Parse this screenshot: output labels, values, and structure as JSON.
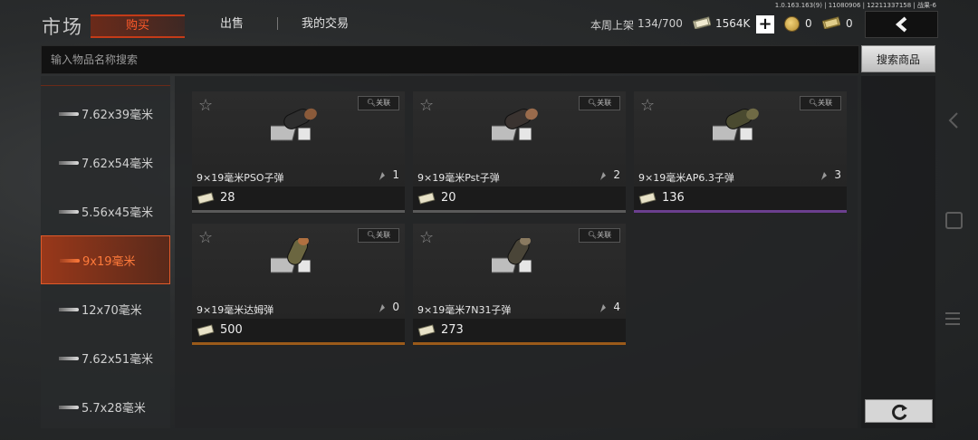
{
  "header": {
    "title": "市场",
    "tabs": [
      {
        "label": "购买",
        "active": true
      },
      {
        "label": "出售",
        "active": false
      },
      {
        "label": "我的交易",
        "active": false
      }
    ],
    "version": "1.0.163.163(9) | 11080906 | 12211337158 | 战果-6",
    "weekly_label": "本周上架",
    "weekly_count": "134/700",
    "money": "1564K",
    "coins": "0",
    "bonds": "0",
    "icons": {
      "plus": "plus-icon",
      "coin": "coin-icon",
      "back": "back-arrow-icon"
    }
  },
  "search": {
    "placeholder": "输入物品名称搜索",
    "button_label": "搜索商品"
  },
  "sidebar": {
    "items": [
      {
        "label": "7.62x39毫米",
        "active": false
      },
      {
        "label": "7.62x54毫米",
        "active": false
      },
      {
        "label": "5.56x45毫米",
        "active": false
      },
      {
        "label": "9x19毫米",
        "active": true
      },
      {
        "label": "12x70毫米",
        "active": false
      },
      {
        "label": "7.62x51毫米",
        "active": false
      },
      {
        "label": "5.7x28毫米",
        "active": false
      }
    ]
  },
  "items": [
    {
      "name": "9×19毫米PSO子弹",
      "qty": "1",
      "price": "28",
      "related": "关联",
      "tip": "#8a5a3a",
      "rarity": "#5a5a5a"
    },
    {
      "name": "9×19毫米Pst子弹",
      "qty": "2",
      "price": "20",
      "related": "关联",
      "tip": "#9a6b4c",
      "rarity": "#5a5a5a"
    },
    {
      "name": "9×19毫米AP6.3子弹",
      "qty": "3",
      "price": "136",
      "related": "关联",
      "tip": "#6f6a45",
      "rarity": "#6b3f8f"
    },
    {
      "name": "9×19毫米达姆弹",
      "qty": "0",
      "price": "500",
      "related": "关联",
      "tip": "#b07040",
      "rarity": "#9a5a1a"
    },
    {
      "name": "9×19毫米7N31子弹",
      "qty": "4",
      "price": "273",
      "related": "关联",
      "tip": "#8a7a60",
      "rarity": "#9a5a1a"
    }
  ],
  "colors": {
    "accent": "#e05a2a",
    "background": "#2a2c2d"
  }
}
